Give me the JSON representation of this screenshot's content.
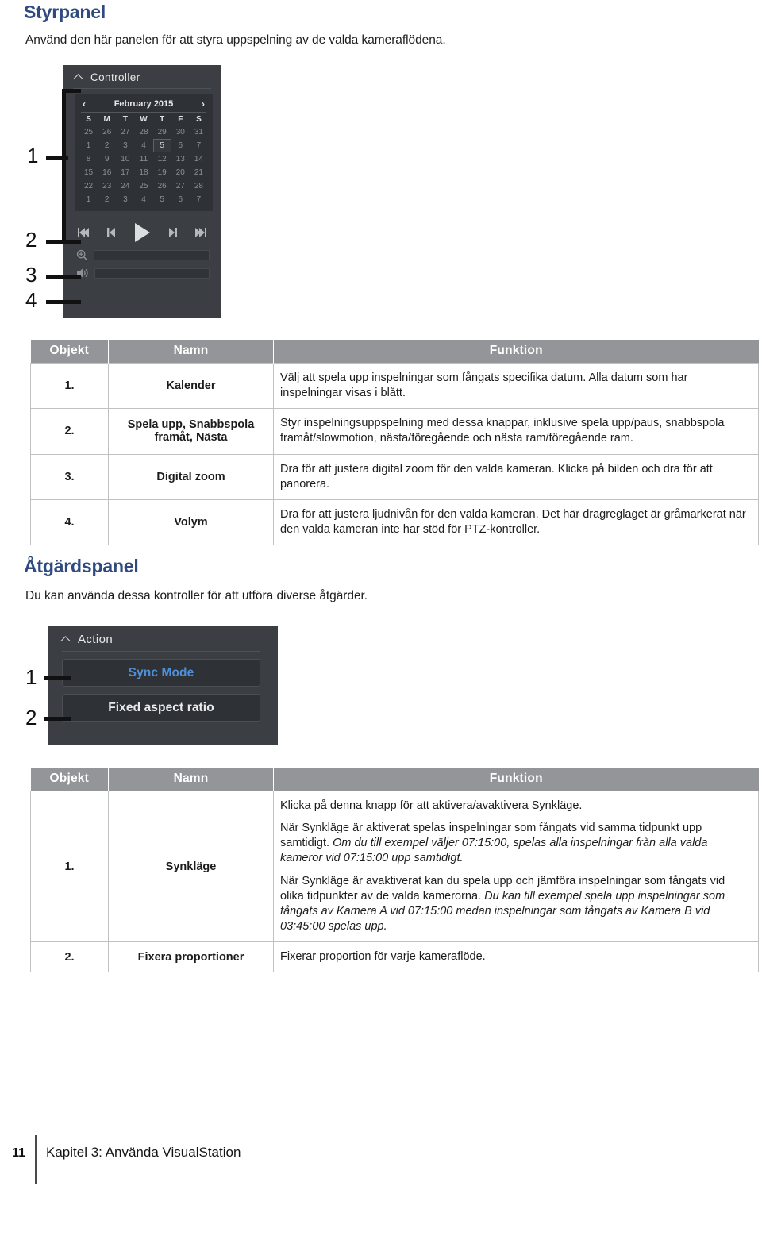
{
  "document": {
    "language": "sv"
  },
  "sections": [
    {
      "title": "Styrpanel",
      "intro": "Använd den här panelen för att styra uppspelning av de valda kameraflödena."
    },
    {
      "title": "Åtgärdspanel",
      "intro": "Du kan använda dessa kontroller för att utföra diverse åtgärder."
    }
  ],
  "controller_screenshot": {
    "panel_title": "Controller",
    "collapse_icon": "chevron-up-icon",
    "calendar": {
      "prev_label": "‹",
      "next_label": "›",
      "month_label": "February 2015",
      "weekday_headers": [
        "S",
        "M",
        "T",
        "W",
        "T",
        "F",
        "S"
      ],
      "weeks": [
        [
          "25",
          "26",
          "27",
          "28",
          "29",
          "30",
          "31"
        ],
        [
          "1",
          "2",
          "3",
          "4",
          "5",
          "6",
          "7"
        ],
        [
          "8",
          "9",
          "10",
          "11",
          "12",
          "13",
          "14"
        ],
        [
          "15",
          "16",
          "17",
          "18",
          "19",
          "20",
          "21"
        ],
        [
          "22",
          "23",
          "24",
          "25",
          "26",
          "27",
          "28"
        ],
        [
          "1",
          "2",
          "3",
          "4",
          "5",
          "6",
          "7"
        ]
      ],
      "selected_day": "5",
      "selected_week_index": 1,
      "selected_day_index": 4
    },
    "transport_icons": [
      "skip-to-start-icon",
      "previous-frame-icon",
      "play-icon",
      "next-frame-icon",
      "skip-to-end-icon"
    ],
    "sliders": [
      {
        "icon": "zoom-in-icon",
        "value": 0
      },
      {
        "icon": "volume-icon",
        "value": 0
      }
    ],
    "callouts": [
      "1",
      "2",
      "3",
      "4"
    ]
  },
  "action_screenshot": {
    "panel_title": "Action",
    "collapse_icon": "chevron-up-icon",
    "buttons": [
      {
        "label": "Sync Mode",
        "accent": true
      },
      {
        "label": "Fixed aspect ratio",
        "accent": false
      }
    ],
    "callouts": [
      "1",
      "2"
    ],
    "accent_color": "#4d90d9"
  },
  "controller_table": {
    "headers": [
      "Objekt",
      "Namn",
      "Funktion"
    ],
    "rows": [
      {
        "item": "1.",
        "name": "Kalender",
        "function": [
          {
            "text": "Välj att spela upp inspelningar som fångats specifika datum. Alla datum som har inspelningar visas i blått.",
            "italic": false
          }
        ]
      },
      {
        "item": "2.",
        "name": "Spela upp, Snabbspola framåt, Nästa",
        "function": [
          {
            "text": "Styr inspelningsuppspelning med dessa knappar, inklusive spela upp/paus, snabbspola framåt/slowmotion, nästa/föregående och nästa ram/föregående ram.",
            "italic": false
          }
        ]
      },
      {
        "item": "3.",
        "name": "Digital zoom",
        "function": [
          {
            "text": "Dra för att justera digital zoom för den valda kameran. Klicka på bilden och dra för att panorera.",
            "italic": false
          }
        ]
      },
      {
        "item": "4.",
        "name": "Volym",
        "function": [
          {
            "text": "Dra för att justera ljudnivån för den valda kameran. Det här dragreglaget är gråmarkerat när den valda kameran inte har stöd för PTZ-kontroller.",
            "italic": false
          }
        ]
      }
    ]
  },
  "action_table": {
    "headers": [
      "Objekt",
      "Namn",
      "Funktion"
    ],
    "rows": [
      {
        "item": "1.",
        "name": "Synkläge",
        "function_paragraphs": [
          [
            {
              "text": "Klicka på denna knapp för att aktivera/avaktivera Synkläge.",
              "italic": false
            }
          ],
          [
            {
              "text": "När Synkläge är aktiverat spelas inspelningar som fångats vid samma tidpunkt upp samtidigt. ",
              "italic": false
            },
            {
              "text": "Om du till exempel väljer 07:15:00, spelas alla inspelningar från alla valda kameror vid 07:15:00 upp samtidigt.",
              "italic": true
            }
          ],
          [
            {
              "text": "När Synkläge är avaktiverat kan du spela upp och jämföra inspelningar som fångats vid olika tidpunkter av de valda kamerorna. ",
              "italic": false
            },
            {
              "text": "Du kan till exempel spela upp inspelningar som fångats av Kamera A vid 07:15:00 medan inspelningar som fångats av Kamera B vid 03:45:00 spelas upp.",
              "italic": true
            }
          ]
        ]
      },
      {
        "item": "2.",
        "name": "Fixera proportioner",
        "function_paragraphs": [
          [
            {
              "text": "Fixerar proportion för varje kameraflöde.",
              "italic": false
            }
          ]
        ]
      }
    ]
  },
  "footer": {
    "page_number": "11",
    "text": "Kapitel 3: Använda VisualStation"
  },
  "colors": {
    "heading": "#2f4a80",
    "table_header_bg": "#939598",
    "panel_bg": "#3b3f44",
    "panel_inner_bg": "#2e3236",
    "accent": "#4d90d9",
    "calendar_selection_border": "#3d6d80"
  }
}
